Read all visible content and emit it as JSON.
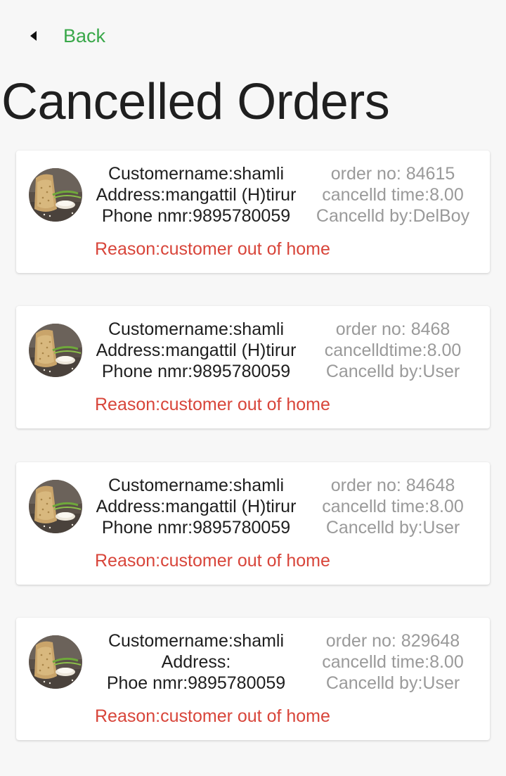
{
  "header": {
    "back_label": "Back",
    "title": "Cancelled Orders"
  },
  "orders": [
    {
      "customer": "Customername:shamli",
      "address": "Address:mangattil (H)tirur",
      "phone": "Phone nmr:9895780059",
      "order_no": "order no: 84615",
      "cancel_time": "cancelld time:8.00",
      "cancel_by": "Cancelld by:DelBoy",
      "reason": "Reason:customer out of home"
    },
    {
      "customer": "Customername:shamli",
      "address": "Address:mangattil (H)tirur",
      "phone": "Phone nmr:9895780059",
      "order_no": "order no: 8468",
      "cancel_time": "cancelldtime:8.00",
      "cancel_by": "Cancelld by:User",
      "reason": "Reason:customer out of home"
    },
    {
      "customer": "Customername:shamli",
      "address": "Address:mangattil (H)tirur",
      "phone": "Phone nmr:9895780059",
      "order_no": "order no: 84648",
      "cancel_time": "cancelld time:8.00",
      "cancel_by": "Cancelld by:User",
      "reason": "Reason:customer out of home"
    },
    {
      "customer": "Customername:shamli",
      "address": "Address:",
      "phone": "Phoe nmr:9895780059",
      "order_no": "order no: 829648",
      "cancel_time": "cancelld time:8.00",
      "cancel_by": "Cancelld by:User",
      "reason": "Reason:customer out of home"
    }
  ]
}
